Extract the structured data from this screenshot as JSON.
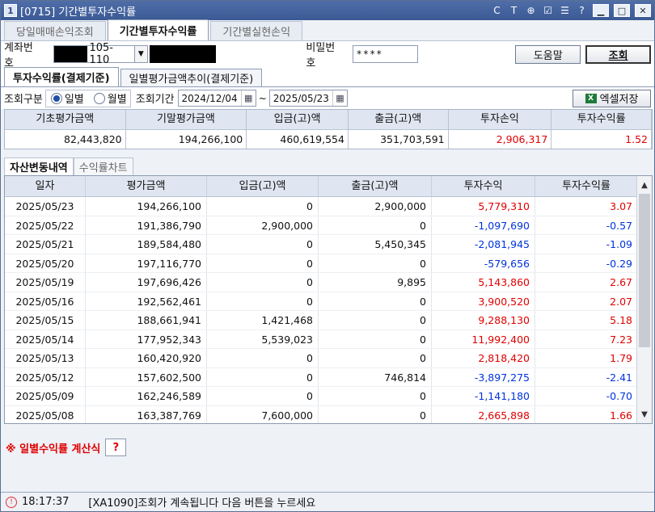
{
  "window": {
    "number": "1",
    "title": "[0715] 기간별투자수익률",
    "tool_icons": [
      "C",
      "T",
      "⊕",
      "☑",
      "☰",
      "?"
    ]
  },
  "top_tabs": [
    {
      "label": "당일매매손익조회",
      "active": false
    },
    {
      "label": "기간별투자수익률",
      "active": true
    },
    {
      "label": "기간별실현손익",
      "active": false
    }
  ],
  "account": {
    "label": "계좌번호",
    "number_suffix": "105-110",
    "password_label": "비밀번호",
    "password_value": "****",
    "help_label": "도움말",
    "query_label": "조회"
  },
  "sub_tabs": [
    {
      "label": "투자수익률(결제기준)",
      "active": true
    },
    {
      "label": "일별평가금액추이(결제기준)",
      "active": false
    }
  ],
  "criteria": {
    "type_label": "조회구분",
    "daily_label": "일별",
    "monthly_label": "월별",
    "selected": "daily",
    "period_label": "조회기간",
    "start_date": "2024/12/04",
    "separator": "~",
    "end_date": "2025/05/23",
    "excel_label": "엑셀저장"
  },
  "summary": {
    "headers": [
      "기초평가금액",
      "기말평가금액",
      "입금(고)액",
      "출금(고)액",
      "투자손익",
      "투자수익률"
    ],
    "values": [
      "82,443,820",
      "194,266,100",
      "460,619,554",
      "351,703,591",
      "2,906,317",
      "1.52"
    ]
  },
  "section_tabs": [
    {
      "label": "자산변동내역",
      "active": true
    },
    {
      "label": "수익률차트",
      "active": false
    }
  ],
  "table": {
    "headers": [
      "일자",
      "평가금액",
      "입금(고)액",
      "출금(고)액",
      "투자수익",
      "투자수익률"
    ],
    "rows": [
      {
        "date": "2025/05/23",
        "eval": "194,266,100",
        "dep": "0",
        "wd": "2,900,000",
        "profit": "5,779,310",
        "rate": "3.07",
        "sign": "pos"
      },
      {
        "date": "2025/05/22",
        "eval": "191,386,790",
        "dep": "2,900,000",
        "wd": "0",
        "profit": "-1,097,690",
        "rate": "-0.57",
        "sign": "neg"
      },
      {
        "date": "2025/05/21",
        "eval": "189,584,480",
        "dep": "0",
        "wd": "5,450,345",
        "profit": "-2,081,945",
        "rate": "-1.09",
        "sign": "neg"
      },
      {
        "date": "2025/05/20",
        "eval": "197,116,770",
        "dep": "0",
        "wd": "0",
        "profit": "-579,656",
        "rate": "-0.29",
        "sign": "neg"
      },
      {
        "date": "2025/05/19",
        "eval": "197,696,426",
        "dep": "0",
        "wd": "9,895",
        "profit": "5,143,860",
        "rate": "2.67",
        "sign": "pos"
      },
      {
        "date": "2025/05/16",
        "eval": "192,562,461",
        "dep": "0",
        "wd": "0",
        "profit": "3,900,520",
        "rate": "2.07",
        "sign": "pos"
      },
      {
        "date": "2025/05/15",
        "eval": "188,661,941",
        "dep": "1,421,468",
        "wd": "0",
        "profit": "9,288,130",
        "rate": "5.18",
        "sign": "pos"
      },
      {
        "date": "2025/05/14",
        "eval": "177,952,343",
        "dep": "5,539,023",
        "wd": "0",
        "profit": "11,992,400",
        "rate": "7.23",
        "sign": "pos"
      },
      {
        "date": "2025/05/13",
        "eval": "160,420,920",
        "dep": "0",
        "wd": "0",
        "profit": "2,818,420",
        "rate": "1.79",
        "sign": "pos"
      },
      {
        "date": "2025/05/12",
        "eval": "157,602,500",
        "dep": "0",
        "wd": "746,814",
        "profit": "-3,897,275",
        "rate": "-2.41",
        "sign": "neg"
      },
      {
        "date": "2025/05/09",
        "eval": "162,246,589",
        "dep": "0",
        "wd": "0",
        "profit": "-1,141,180",
        "rate": "-0.70",
        "sign": "neg"
      },
      {
        "date": "2025/05/08",
        "eval": "163,387,769",
        "dep": "7,600,000",
        "wd": "0",
        "profit": "2,665,898",
        "rate": "1.66",
        "sign": "pos"
      }
    ]
  },
  "formula": {
    "label": "※ 일별수익률 계산식",
    "button": "?"
  },
  "status": {
    "time": "18:17:37",
    "message": "[XA1090]조회가 계속됩니다  다음 버튼을 누르세요"
  },
  "colors": {
    "positive": "#e00000",
    "negative": "#0033dd",
    "titlebar": "#3b5a95"
  }
}
